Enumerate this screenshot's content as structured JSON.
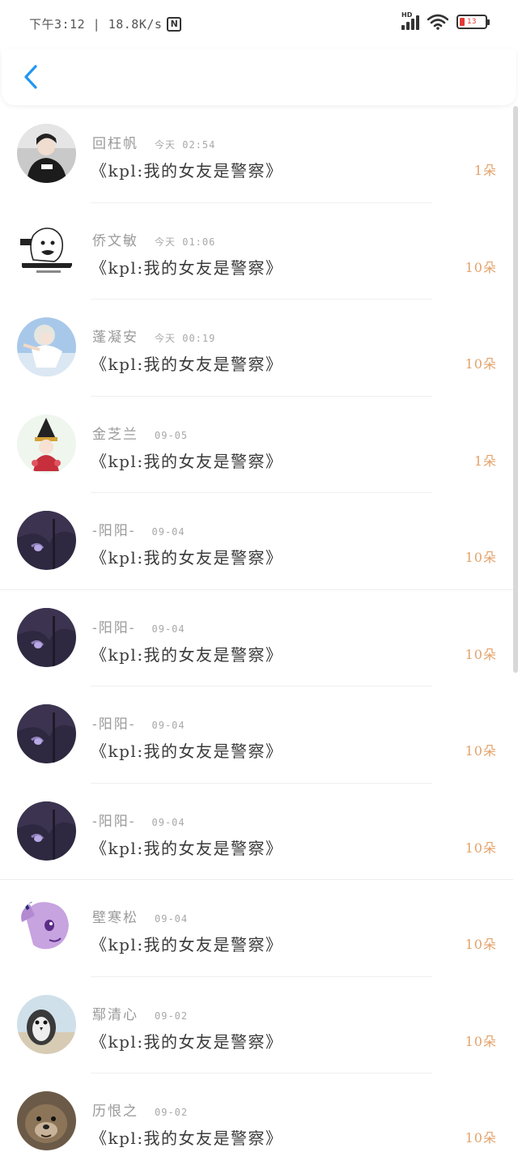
{
  "status_bar": {
    "time_speed": "下午3:12 | 18.8K/s",
    "nfc_label": "N",
    "network": "HD",
    "battery_pct": "13"
  },
  "nav": {
    "back_icon": "chevron-left-icon"
  },
  "colors": {
    "accent": "#2196f3",
    "count": "#e3a26a",
    "battery_low": "#e53935"
  },
  "rows": [
    {
      "user": "回枉帆",
      "time": "今天 02:54",
      "title": "《kpl:我的女友是警察》",
      "count": "1朵",
      "avatar": "photo-person"
    },
    {
      "user": "侨文敏",
      "time": "今天 01:06",
      "title": "《kpl:我的女友是警察》",
      "count": "10朵",
      "avatar": "meme-cartoon"
    },
    {
      "user": "蓬凝安",
      "time": "今天 00:19",
      "title": "《kpl:我的女友是警察》",
      "count": "10朵",
      "avatar": "anime-girl-sky"
    },
    {
      "user": "金芝兰",
      "time": "09-05",
      "title": "《kpl:我的女友是警察》",
      "count": "1朵",
      "avatar": "anime-chibi-hat"
    },
    {
      "user": "-阳阳-",
      "time": "09-04",
      "title": "《kpl:我的女友是警察》",
      "count": "10朵",
      "avatar": "anime-dark-purple"
    },
    {
      "user": "-阳阳-",
      "time": "09-04",
      "title": "《kpl:我的女友是警察》",
      "count": "10朵",
      "avatar": "anime-dark-purple"
    },
    {
      "user": "-阳阳-",
      "time": "09-04",
      "title": "《kpl:我的女友是警察》",
      "count": "10朵",
      "avatar": "anime-dark-purple"
    },
    {
      "user": "-阳阳-",
      "time": "09-04",
      "title": "《kpl:我的女友是警察》",
      "count": "10朵",
      "avatar": "anime-dark-purple"
    },
    {
      "user": "壁寒松",
      "time": "09-04",
      "title": "《kpl:我的女友是警察》",
      "count": "10朵",
      "avatar": "pony-purple"
    },
    {
      "user": "鄢清心",
      "time": "09-02",
      "title": "《kpl:我的女友是警察》",
      "count": "10朵",
      "avatar": "penguin-beach"
    },
    {
      "user": "历恨之",
      "time": "09-02",
      "title": "《kpl:我的女友是警察》",
      "count": "10朵",
      "avatar": "otter-face"
    }
  ]
}
